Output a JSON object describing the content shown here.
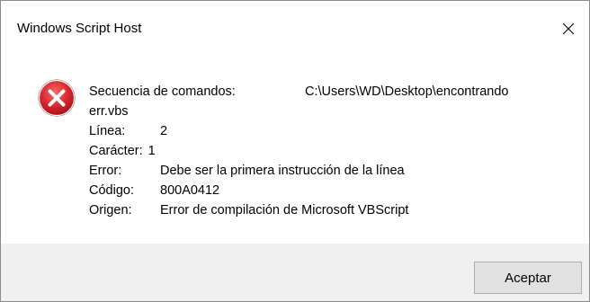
{
  "window": {
    "title": "Windows Script Host"
  },
  "icons": {
    "close": "close-icon",
    "error": "error-icon"
  },
  "colors": {
    "error_red": "#d8262e",
    "footer_bg": "#f0f0f0",
    "button_bg": "#e1e1e1",
    "button_border": "#adadad"
  },
  "message": {
    "script_label": "Secuencia de comandos:",
    "script_path": "C:\\Users\\WD\\Desktop\\encontrando",
    "script_path_cont": "err.vbs",
    "line_label": "Línea:",
    "line_value": "2",
    "char_label": "Carácter:",
    "char_value": "1",
    "error_label": "Error:",
    "error_value": "Debe ser la primera instrucción de la línea",
    "code_label": "Código:",
    "code_value": "800A0412",
    "source_label": "Origen:",
    "source_value": "Error de compilación de Microsoft VBScript"
  },
  "buttons": {
    "ok_label": "Aceptar"
  }
}
